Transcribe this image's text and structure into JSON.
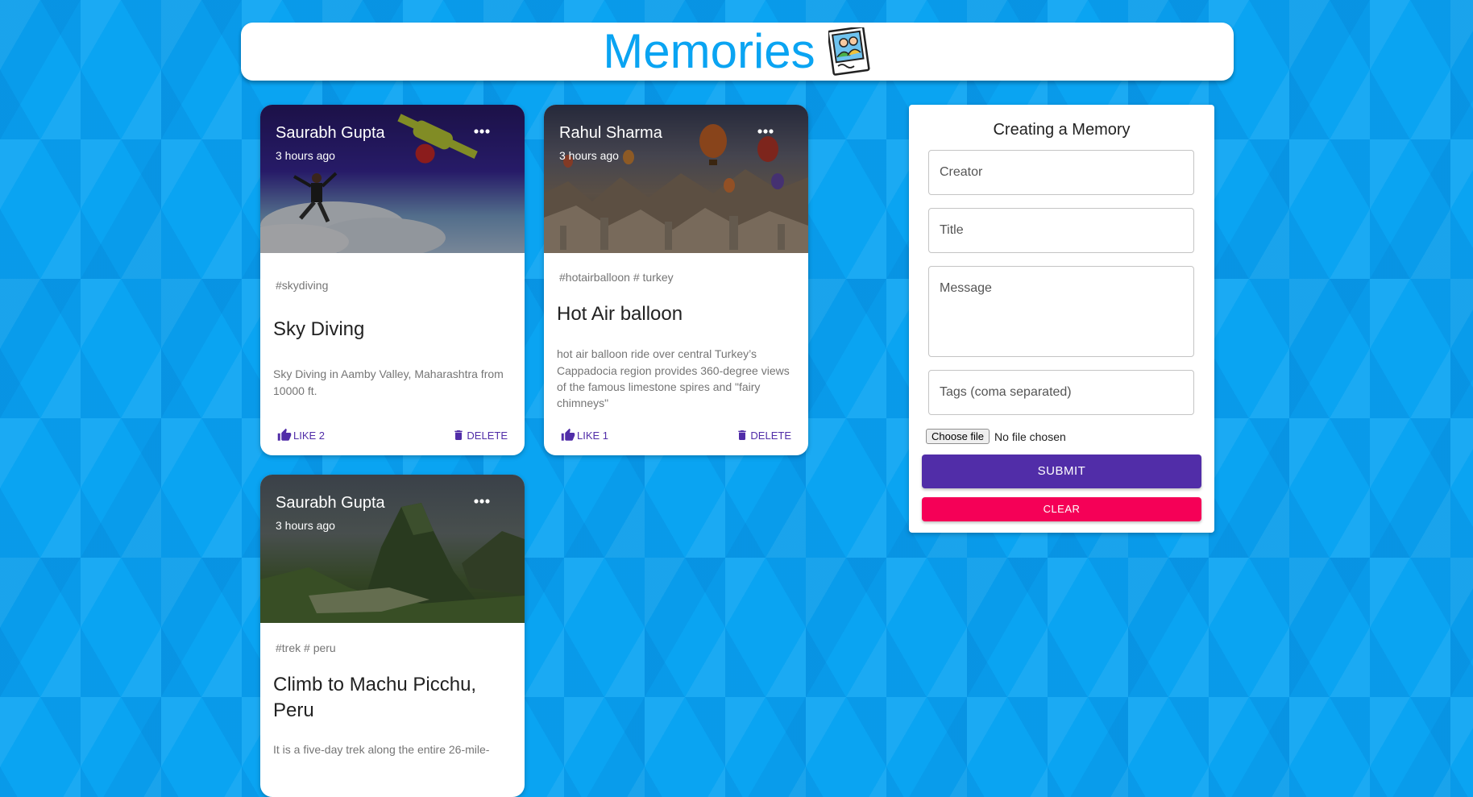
{
  "app": {
    "title": "Memories"
  },
  "posts": [
    {
      "creator": "Saurabh Gupta",
      "time": "3 hours ago",
      "tags": "#skydiving",
      "title": "Sky Diving",
      "message": "Sky Diving in Aamby Valley, Maharashtra from 10000 ft.",
      "like_label": "LIKE 2",
      "delete_label": "DELETE"
    },
    {
      "creator": "Rahul Sharma",
      "time": "3 hours ago",
      "tags": "#hotairballoon # turkey",
      "title": "Hot Air balloon",
      "message": "hot air balloon ride over central Turkey’s Cappadocia region provides 360-degree views of the famous limestone spires and \"fairy chimneys\"",
      "like_label": "LIKE 1",
      "delete_label": "DELETE"
    },
    {
      "creator": "Saurabh Gupta",
      "time": "3 hours ago",
      "tags": "#trek # peru",
      "title": "Climb to Machu Picchu, Peru",
      "message": "It is a five-day trek along the entire 26-mile-"
    }
  ],
  "form": {
    "heading": "Creating a Memory",
    "creator_placeholder": "Creator",
    "title_placeholder": "Title",
    "message_placeholder": "Message",
    "tags_placeholder": "Tags (coma separated)",
    "file_button": "Choose file",
    "file_status": "No file chosen",
    "submit_label": "SUBMIT",
    "clear_label": "CLEAR"
  },
  "colors": {
    "brand": "#0aa4f2",
    "action": "#512da8",
    "submit": "#512da8",
    "clear": "#f50057"
  }
}
